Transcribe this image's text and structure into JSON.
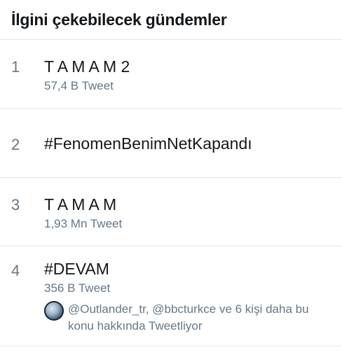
{
  "header": {
    "title": "İlgini çekebilecek gündemler"
  },
  "trends": [
    {
      "rank": "1",
      "name": "T A M A M 2",
      "count": "57,4 B Tweet"
    },
    {
      "rank": "2",
      "name": "#FenomenBenimNetKapandı"
    },
    {
      "rank": "3",
      "name": "T A M A M",
      "count": "1,93 Mn Tweet"
    },
    {
      "rank": "4",
      "name": "#DEVAM",
      "count": "356 B Tweet",
      "context": "@Outlander_tr, @bbcturkce ve 6 kişi daha bu konu hakkında Tweetliyor",
      "context_avatar_icon": "moon-avatar"
    }
  ],
  "colors": {
    "primary_text": "#14171a",
    "secondary_text": "#657786",
    "divider": "#e1e8ed",
    "background": "#ffffff"
  }
}
